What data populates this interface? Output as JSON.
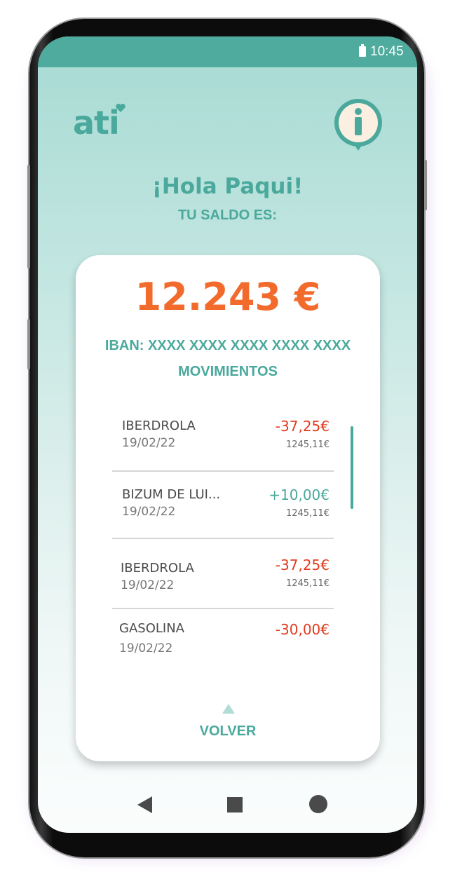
{
  "status_bar": {
    "time": "10:45",
    "battery_icon": "battery-icon"
  },
  "header": {
    "logo_text": "ati",
    "info_icon": "info-icon"
  },
  "greeting": "¡Hola Paqui!",
  "balance_label": "TU SALDO ES:",
  "account": {
    "balance": "12.243 €",
    "iban": "IBAN: XXXX XXXX XXXX XXXX XXXX",
    "movements_title": "MOVIMIENTOS"
  },
  "transactions": [
    {
      "name": "IBERDROLA",
      "date": "19/02/22",
      "amount": "-37,25€",
      "balance_after": "1245,11€",
      "type": "negative"
    },
    {
      "name": "BIZUM DE LUI...",
      "date": "19/02/22",
      "amount": "+10,00€",
      "balance_after": "1245,11€",
      "type": "positive"
    },
    {
      "name": "IBERDROLA",
      "date": "19/02/22",
      "amount": "-37,25€",
      "balance_after": "1245,11€",
      "type": "negative"
    },
    {
      "name": "GASOLINA",
      "date": "19/02/22",
      "amount": "-30,00€",
      "balance_after": "",
      "type": "negative"
    }
  ],
  "back_label": "VOLVER",
  "colors": {
    "brand": "#4aa99c",
    "balance": "#f26b2d",
    "negative": "#e23b1e"
  },
  "nav": {
    "back_icon": "triangle-back-icon",
    "home_icon": "square-home-icon",
    "recent_icon": "circle-recent-icon"
  }
}
